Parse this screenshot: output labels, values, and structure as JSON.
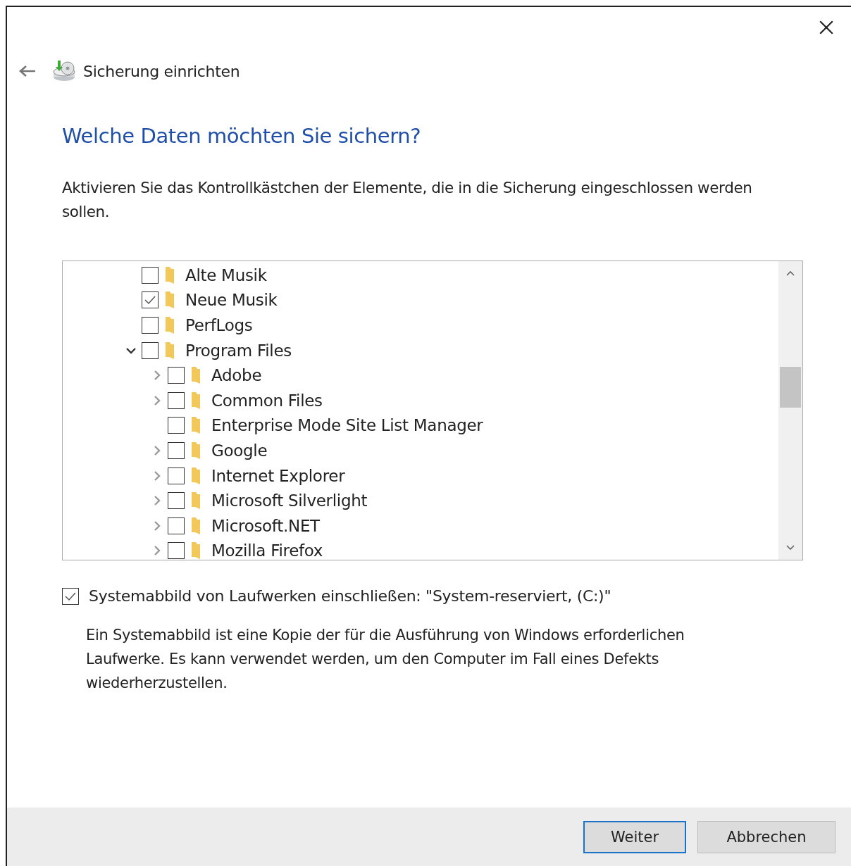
{
  "window": {
    "title": "Sicherung einrichten"
  },
  "heading": "Welche Daten möchten Sie sichern?",
  "instruction": "Aktivieren Sie das Kontrollkästchen der Elemente, die in die Sicherung eingeschlossen werden sollen.",
  "tree": [
    {
      "label": "Alte Musik",
      "checked": false
    },
    {
      "label": "Neue Musik",
      "checked": true
    },
    {
      "label": "PerfLogs",
      "checked": false
    },
    {
      "label": "Program Files",
      "checked": false,
      "expanded": true,
      "children": [
        {
          "label": "Adobe",
          "checked": false,
          "expanded": false
        },
        {
          "label": "Common Files",
          "checked": false,
          "expanded": false
        },
        {
          "label": "Enterprise Mode Site List Manager",
          "checked": false
        },
        {
          "label": "Google",
          "checked": false,
          "expanded": false
        },
        {
          "label": "Internet Explorer",
          "checked": false,
          "expanded": false
        },
        {
          "label": "Microsoft Silverlight",
          "checked": false,
          "expanded": false
        },
        {
          "label": "Microsoft.NET",
          "checked": false,
          "expanded": false
        },
        {
          "label": "Mozilla Firefox",
          "checked": false,
          "expanded": false
        }
      ]
    }
  ],
  "system_image": {
    "label": "Systemabbild von Laufwerken einschließen: \"System-reserviert, (C:)\"",
    "checked": true
  },
  "description": "Ein Systemabbild ist eine Kopie der für die Ausführung von Windows erforderlichen Laufwerke. Es kann verwendet werden, um den Computer im Fall eines Defekts wiederherzustellen.",
  "buttons": [
    {
      "label": "Weiter",
      "selected": true
    },
    {
      "label": "Abbrechen",
      "selected": false
    }
  ]
}
